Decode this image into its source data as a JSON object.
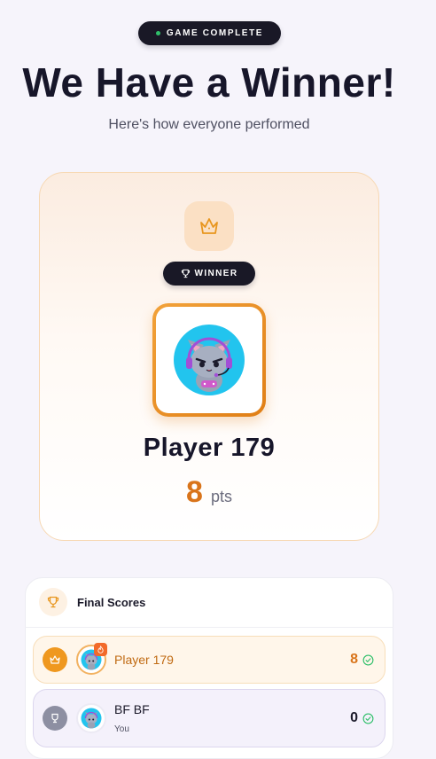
{
  "top_badge": {
    "label": "GAME COMPLETE"
  },
  "headline": "We Have a Winner!",
  "subhead": "Here's how everyone performed",
  "winner": {
    "badge_label": "WINNER",
    "name": "Player 179",
    "points": "8",
    "points_unit": "pts"
  },
  "scores": {
    "title": "Final Scores",
    "rows": [
      {
        "name": "Player 179",
        "score": "8",
        "sub": ""
      },
      {
        "name": "BF BF",
        "score": "0",
        "sub": "You"
      }
    ]
  },
  "colors": {
    "accent": "#e07f16",
    "dark": "#191826",
    "success": "#2fbf6a"
  },
  "icons": [
    "crown-icon",
    "trophy-icon",
    "fire-icon",
    "check-circle-icon",
    "medal-icon"
  ]
}
